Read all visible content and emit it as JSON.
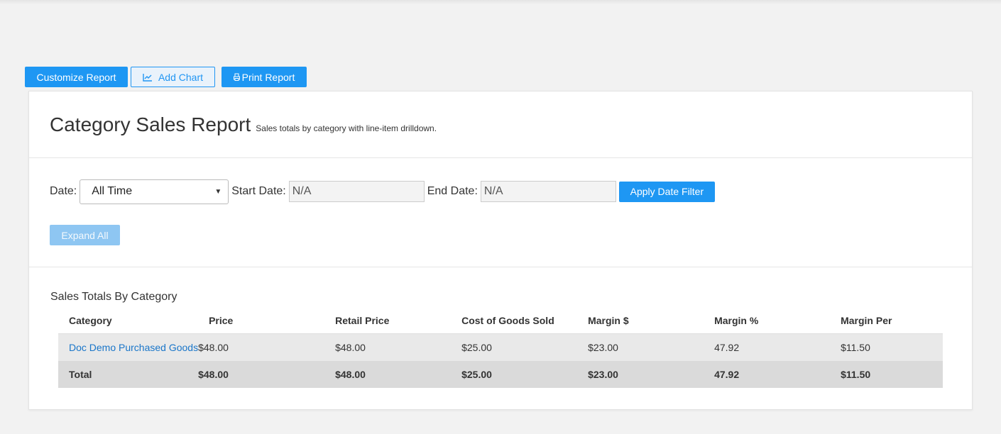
{
  "toolbar": {
    "customize_label": "Customize Report",
    "add_chart_label": "Add Chart",
    "print_label": "Print Report"
  },
  "report": {
    "title": "Category Sales Report",
    "subtitle": "Sales totals by category with line-item drilldown."
  },
  "filters": {
    "date_label": "Date:",
    "date_value": "All Time",
    "start_label": "Start Date:",
    "start_value": "N/A",
    "end_label": "End Date:",
    "end_value": "N/A",
    "apply_label": "Apply Date Filter",
    "expand_label": "Expand All"
  },
  "table": {
    "section_title": "Sales Totals By Category",
    "headers": [
      "Category",
      "Price",
      "Retail Price",
      "Cost of Goods Sold",
      "Margin $",
      "Margin %",
      "Margin Per"
    ],
    "rows": [
      [
        "Doc Demo Purchased Goods",
        "$48.00",
        "$48.00",
        "$25.00",
        "$23.00",
        "47.92",
        "$11.50"
      ]
    ],
    "total": [
      "Total",
      "$48.00",
      "$48.00",
      "$25.00",
      "$23.00",
      "47.92",
      "$11.50"
    ]
  },
  "colors": {
    "accent": "#1e97f3",
    "link": "#1a76c9",
    "background": "#f2f2f2"
  },
  "icons": [
    "line-chart-icon",
    "printer-icon",
    "chevron-down-icon"
  ]
}
